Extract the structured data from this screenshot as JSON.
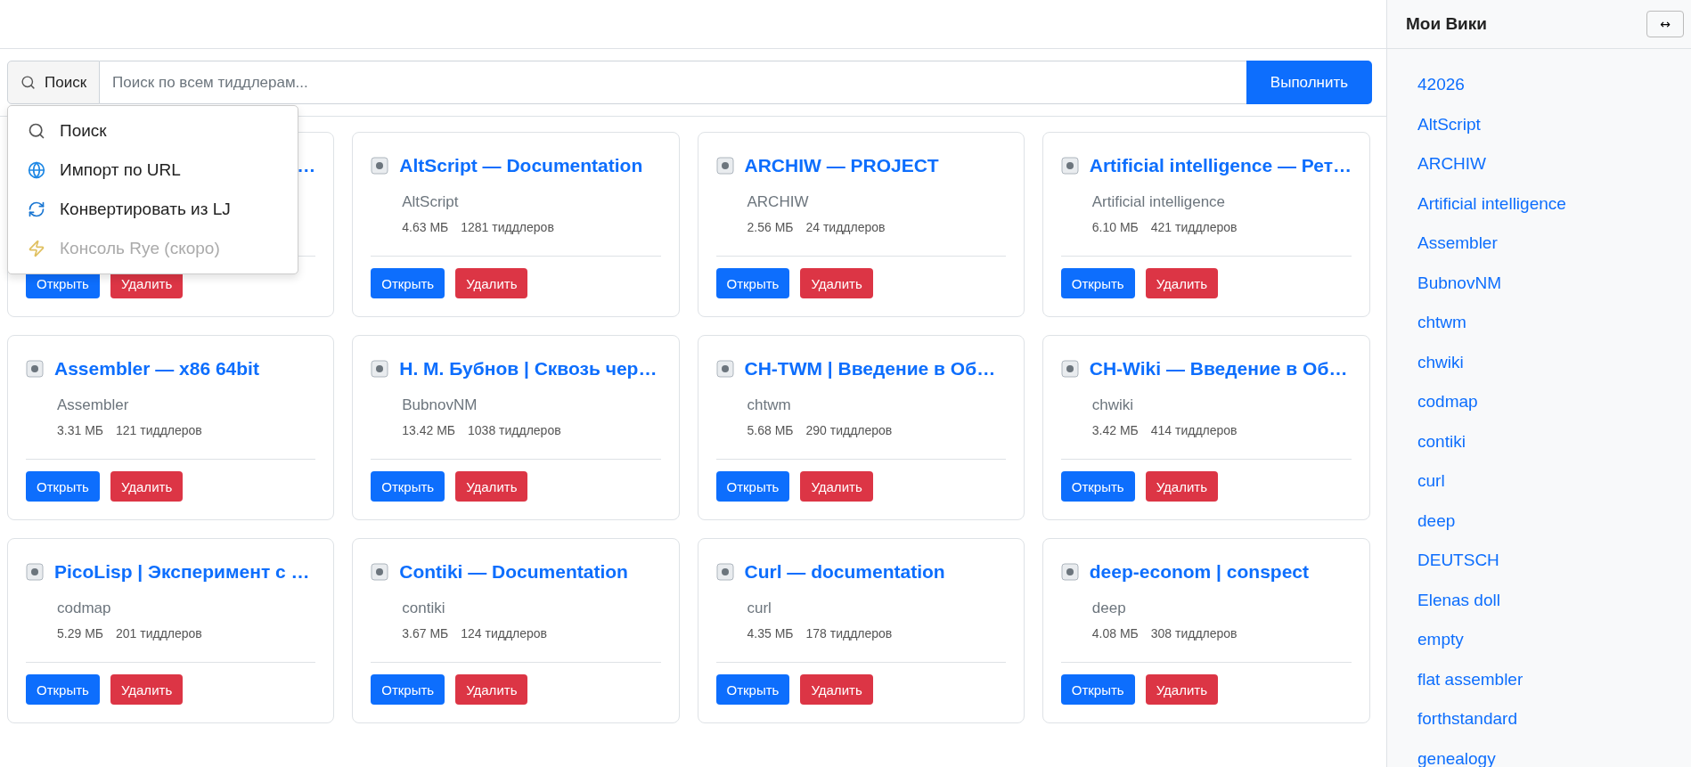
{
  "search": {
    "mode_button": "Поиск",
    "placeholder": "Поиск по всем тиддлерам...",
    "submit": "Выполнить"
  },
  "menu": {
    "items": [
      {
        "kind": "search",
        "label": "Поиск",
        "disabled": false
      },
      {
        "kind": "globe",
        "label": "Импорт по URL",
        "disabled": false
      },
      {
        "kind": "convert",
        "label": "Конвертировать из LJ",
        "disabled": false
      },
      {
        "kind": "bolt",
        "label": "Консоль Rye (скоро)",
        "disabled": true
      }
    ]
  },
  "cards": [
    {
      "title": "…",
      "covered": true,
      "open": "Открыть",
      "delete": "Удалить"
    },
    {
      "title": "AltScript — Documentation",
      "covered": false,
      "name": "AltScript",
      "size": "4.63 МБ",
      "count": "1281 тиддлеров",
      "open": "Открыть",
      "delete": "Удалить"
    },
    {
      "title": "ARCHIW — PROJECT",
      "covered": false,
      "name": "ARCHIW",
      "size": "2.56 МБ",
      "count": "24 тиддлеров",
      "open": "Открыть",
      "delete": "Удалить"
    },
    {
      "title": "Artificial intelligence — Рет…",
      "covered": false,
      "name": "Artificial intelligence",
      "size": "6.10 МБ",
      "count": "421 тиддлеров",
      "open": "Открыть",
      "delete": "Удалить"
    },
    {
      "title": "Assembler — x86 64bit",
      "covered": false,
      "name": "Assembler",
      "size": "3.31 МБ",
      "count": "121 тиддлеров",
      "open": "Открыть",
      "delete": "Удалить"
    },
    {
      "title": "Н. М. Бубнов | Сквозь чер…",
      "covered": false,
      "name": "BubnovNM",
      "size": "13.42 МБ",
      "count": "1038 тиддлеров",
      "open": "Открыть",
      "delete": "Удалить"
    },
    {
      "title": "CH-TWM | Введение в Об…",
      "covered": false,
      "name": "chtwm",
      "size": "5.68 МБ",
      "count": "290 тиддлеров",
      "open": "Открыть",
      "delete": "Удалить"
    },
    {
      "title": "CH-Wiki — Введение в Об…",
      "covered": false,
      "name": "chwiki",
      "size": "3.42 МБ",
      "count": "414 тиддлеров",
      "open": "Открыть",
      "delete": "Удалить"
    },
    {
      "title": "PicoLisp | Эксперимент с …",
      "covered": false,
      "name": "codmap",
      "size": "5.29 МБ",
      "count": "201 тиддлеров",
      "open": "Открыть",
      "delete": "Удалить"
    },
    {
      "title": "Contiki — Documentation",
      "covered": false,
      "name": "contiki",
      "size": "3.67 МБ",
      "count": "124 тиддлеров",
      "open": "Открыть",
      "delete": "Удалить"
    },
    {
      "title": "Curl — documentation",
      "covered": false,
      "name": "curl",
      "size": "4.35 МБ",
      "count": "178 тиддлеров",
      "open": "Открыть",
      "delete": "Удалить"
    },
    {
      "title": "deep-econom | conspect",
      "covered": false,
      "name": "deep",
      "size": "4.08 МБ",
      "count": "308 тиддлеров",
      "open": "Открыть",
      "delete": "Удалить"
    }
  ],
  "sidebar": {
    "title": "Мои Вики",
    "toggle": "↔",
    "items": [
      "42026",
      "AltScript",
      "ARCHIW",
      "Artificial intelligence",
      "Assembler",
      "BubnovNM",
      "chtwm",
      "chwiki",
      "codmap",
      "contiki",
      "curl",
      "deep",
      "DEUTSCH",
      "Elenas doll",
      "empty",
      "flat assembler",
      "forthstandard",
      "genealogy"
    ]
  }
}
